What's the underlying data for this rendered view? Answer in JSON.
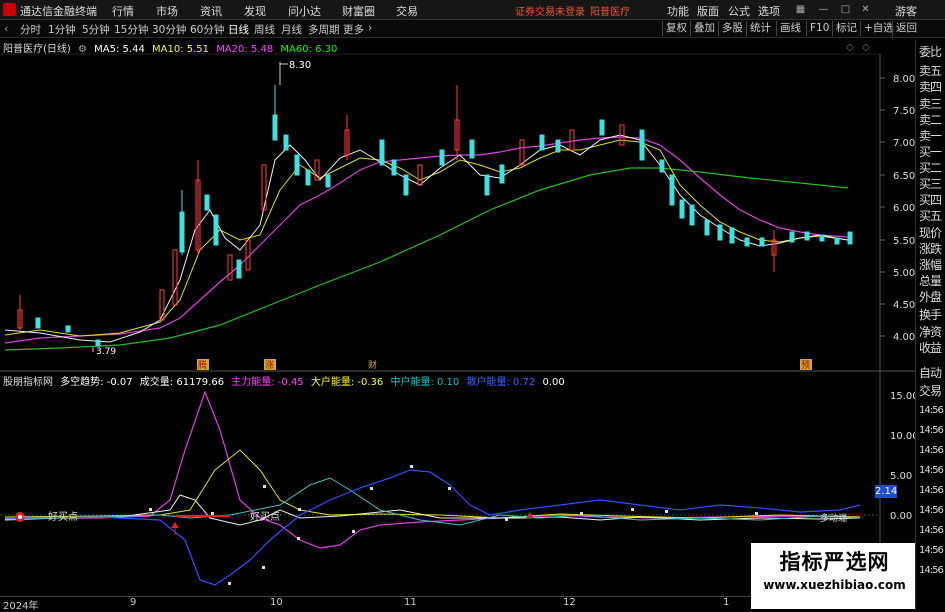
{
  "topbar": {
    "app_title": "通达信金融终端",
    "menu": [
      "行情",
      "市场",
      "资讯",
      "发现",
      "问小达",
      "财富圈",
      "交易"
    ],
    "notice": "证券交易未登录",
    "stock_name": "阳普医疗",
    "right_menu": [
      "功能",
      "版面",
      "公式",
      "选项"
    ],
    "user": "游客"
  },
  "periodbar": {
    "periods": [
      "分时",
      "1分钟",
      "5分钟",
      "15分钟",
      "30分钟",
      "60分钟",
      "日线",
      "周线",
      "月线",
      "多周期",
      "更多"
    ],
    "active": "日线",
    "tools": [
      "复权",
      "叠加",
      "多股",
      "统计",
      "画线",
      "F10",
      "标记",
      "+自选",
      "返回"
    ]
  },
  "main_info": {
    "title": "阳普医疗(日线)",
    "ma5": "MA5: 5.44",
    "ma10": "MA10: 5.51",
    "ma20": "MA20: 5.48",
    "ma60": "MA60: 6.30",
    "colors": {
      "ma5": "#ffffff",
      "ma10": "#ffff00",
      "ma20": "#ff44ff",
      "ma60": "#00ff00"
    }
  },
  "sub_info": {
    "name": "股朋指标网",
    "trend": "多空趋势: -0.07",
    "volume": "成交量: 61179.66",
    "main_force": "主力能量: -0.45",
    "big": "大户能量: -0.36",
    "mid": "中户能量: 0.10",
    "retail": "散户能量: 0.72",
    "zero": "0.00"
  },
  "price_axis": [
    "8.00",
    "7.50",
    "7.00",
    "6.50",
    "6.00",
    "5.50",
    "5.00",
    "4.50",
    "4.00"
  ],
  "sub_axis": [
    "15.00",
    "10.00",
    "5.00",
    "0.00"
  ],
  "annotations": {
    "high": "8.30",
    "low": "3.79",
    "marker1": "腾",
    "marker2": "涨",
    "marker3": "财",
    "marker4": "预",
    "buy1": "好买点",
    "buy2": "好买点",
    "highlight": "2.14",
    "side_text": "多动端"
  },
  "quote_panel": [
    "委比",
    "卖五",
    "卖四",
    "卖三",
    "卖二",
    "卖一",
    "买一",
    "买二",
    "买三",
    "买四",
    "买五",
    "现价",
    "涨跌",
    "涨幅",
    "总量",
    "外盘",
    "换手",
    "净资",
    "收益",
    "自动",
    "交易",
    "14:56",
    "14:56",
    "14:56",
    "14:56",
    "14:56",
    "14:56",
    "14:56",
    "14:56",
    "14:56"
  ],
  "x_axis": [
    "2024年",
    "9",
    "10",
    "11",
    "12",
    "1"
  ],
  "watermark": {
    "title": "指标严选网",
    "url": "www.xuezhibiao.com"
  }
}
